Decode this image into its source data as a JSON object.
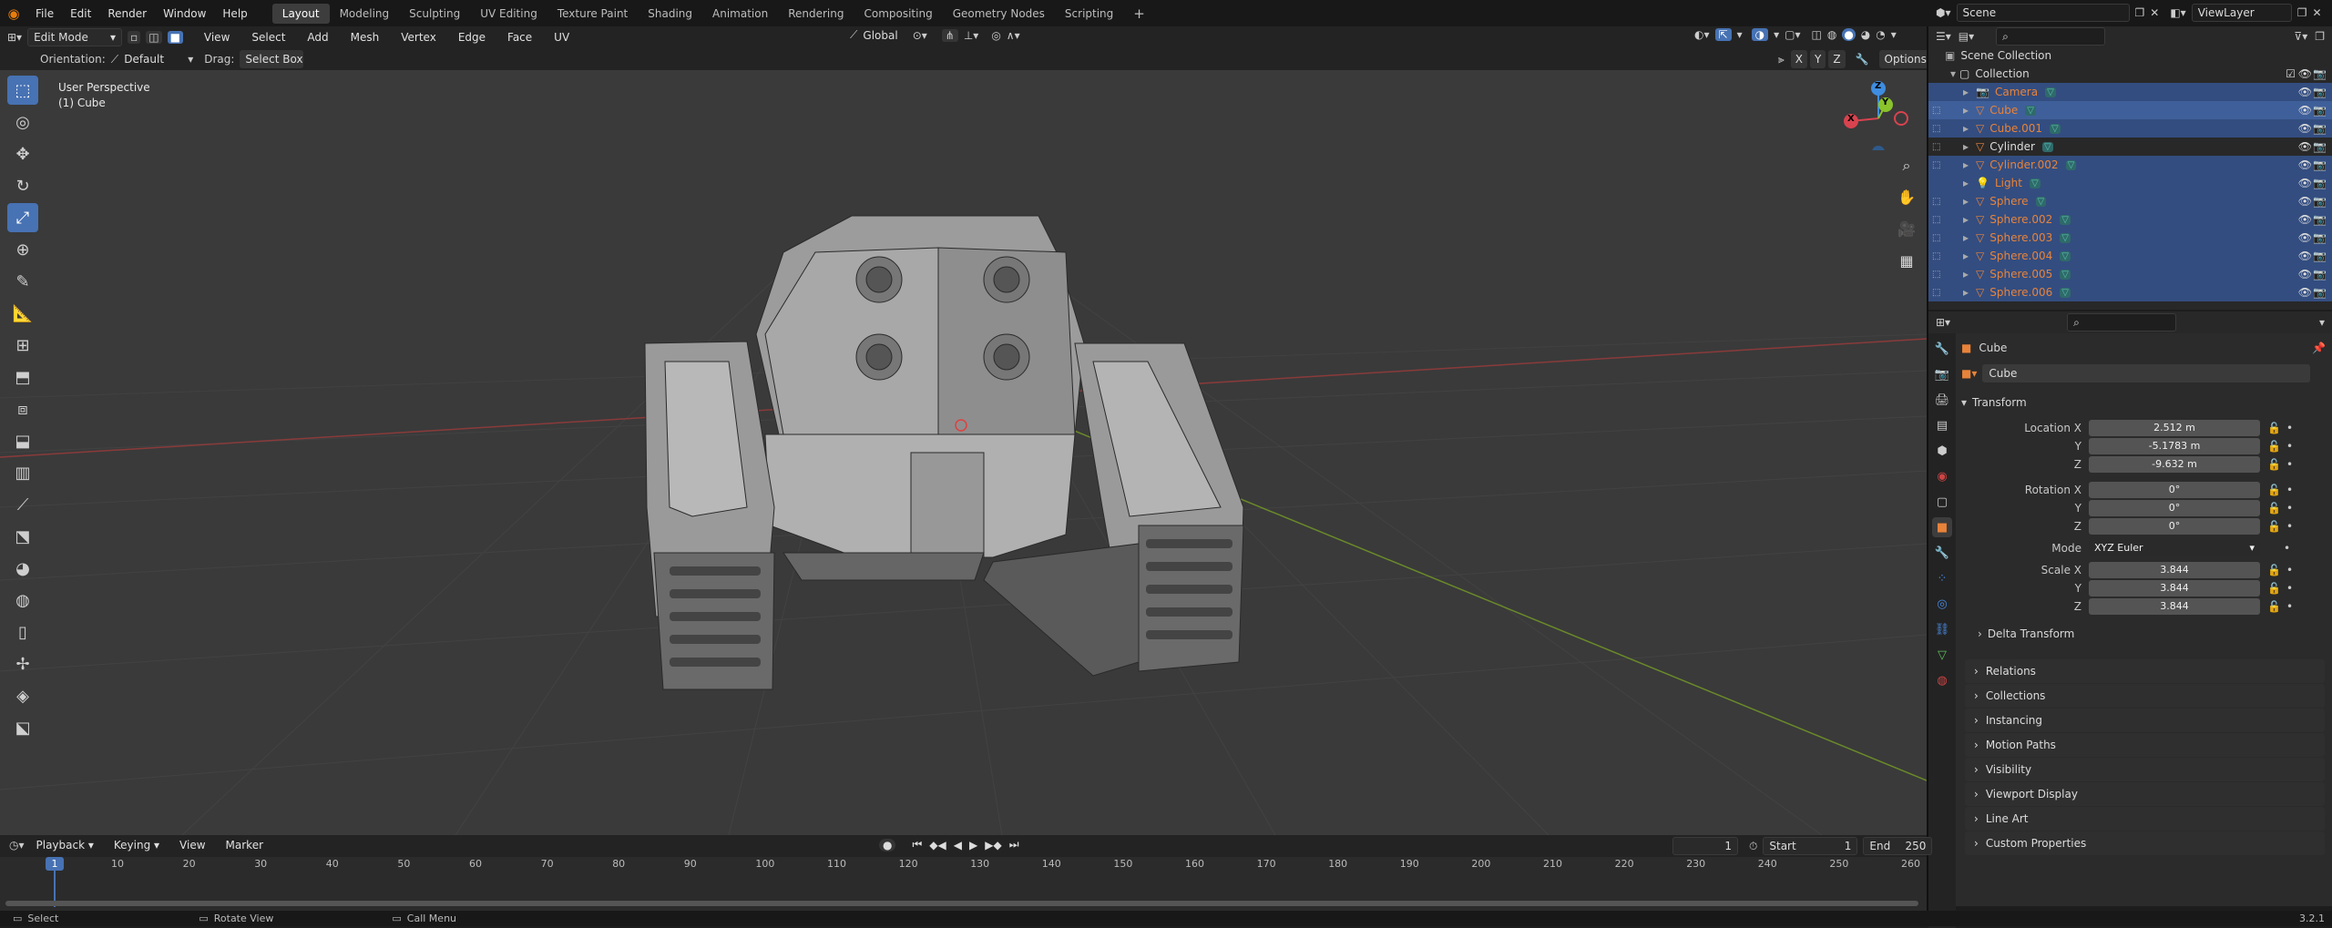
{
  "menus": [
    "File",
    "Edit",
    "Render",
    "Window",
    "Help"
  ],
  "workspaces": [
    "Layout",
    "Modeling",
    "Sculpting",
    "UV Editing",
    "Texture Paint",
    "Shading",
    "Animation",
    "Rendering",
    "Compositing",
    "Geometry Nodes",
    "Scripting"
  ],
  "add_workspace_icon": "+",
  "scene": {
    "label": "Scene",
    "view_layer": "ViewLayer"
  },
  "viewport_header": {
    "mode": "Edit Mode",
    "menus": [
      "View",
      "Select",
      "Add",
      "Mesh",
      "Vertex",
      "Edge",
      "Face",
      "UV"
    ],
    "transform_orientation": "Global",
    "orientation_label": "Orientation:",
    "orientation_value": "Default",
    "drag_label": "Drag:",
    "drag_value": "Select Box",
    "axes": [
      "X",
      "Y",
      "Z"
    ],
    "options": "Options"
  },
  "viewport_info": {
    "line1": "User Perspective",
    "line2": "(1) Cube"
  },
  "gizmo": {
    "x": "X",
    "y": "Y",
    "z": "Z"
  },
  "tools": [
    "select-box",
    "cursor",
    "move",
    "rotate",
    "scale",
    "transform",
    "annotate",
    "measure",
    "add-cube",
    "extrude",
    "inset",
    "bevel",
    "loop-cut",
    "knife",
    "poly-build",
    "spin",
    "smooth",
    "shrink-fatten",
    "shear",
    "to-sphere",
    "rip"
  ],
  "outliner": {
    "root": "Scene Collection",
    "collection": "Collection",
    "items": [
      {
        "name": "Camera",
        "type": "camera",
        "selected": true
      },
      {
        "name": "Cube",
        "type": "mesh",
        "selected": true,
        "active": true
      },
      {
        "name": "Cube.001",
        "type": "mesh",
        "selected": true
      },
      {
        "name": "Cylinder",
        "type": "mesh",
        "selected": false
      },
      {
        "name": "Cylinder.002",
        "type": "mesh",
        "selected": true
      },
      {
        "name": "Light",
        "type": "light",
        "selected": true
      },
      {
        "name": "Sphere",
        "type": "mesh",
        "selected": true
      },
      {
        "name": "Sphere.002",
        "type": "mesh",
        "selected": true
      },
      {
        "name": "Sphere.003",
        "type": "mesh",
        "selected": true
      },
      {
        "name": "Sphere.004",
        "type": "mesh",
        "selected": true
      },
      {
        "name": "Sphere.005",
        "type": "mesh",
        "selected": true
      },
      {
        "name": "Sphere.006",
        "type": "mesh",
        "selected": true
      }
    ]
  },
  "properties": {
    "object_name": "Cube",
    "object_field": "Cube",
    "transform_title": "Transform",
    "location": {
      "label": "Location X",
      "x": "2.512 m",
      "y": "-5.1783 m",
      "z": "-9.632 m"
    },
    "rotation": {
      "label": "Rotation X",
      "x": "0°",
      "y": "0°",
      "z": "0°"
    },
    "mode": {
      "label": "Mode",
      "value": "XYZ Euler"
    },
    "scale": {
      "label": "Scale X",
      "x": "3.844",
      "y": "3.844",
      "z": "3.844"
    },
    "axis_y": "Y",
    "axis_z": "Z",
    "delta": "Delta Transform",
    "panels": [
      "Relations",
      "Collections",
      "Instancing",
      "Motion Paths",
      "Visibility",
      "Viewport Display",
      "Line Art",
      "Custom Properties"
    ]
  },
  "timeline": {
    "menus": [
      "Playback",
      "Keying",
      "View",
      "Marker"
    ],
    "current_frame": "1",
    "start_label": "Start",
    "start": "1",
    "end_label": "End",
    "end": "250",
    "ticks": [
      "10",
      "20",
      "30",
      "40",
      "50",
      "60",
      "70",
      "80",
      "90",
      "100",
      "110",
      "120",
      "130",
      "140",
      "150",
      "160",
      "170",
      "180",
      "190",
      "200",
      "210",
      "220",
      "230",
      "240",
      "250",
      "260"
    ],
    "playhead": "1"
  },
  "status": {
    "select": "Select",
    "rotate": "Rotate View",
    "call_menu": "Call Menu",
    "version": "3.2.1"
  },
  "colors": {
    "accent": "#4772b3",
    "selected_object": "#e8833a",
    "active_bg": "#334d80",
    "x_axis": "#d8434f",
    "y_axis": "#8ac32c",
    "z_axis": "#3e8de0"
  }
}
